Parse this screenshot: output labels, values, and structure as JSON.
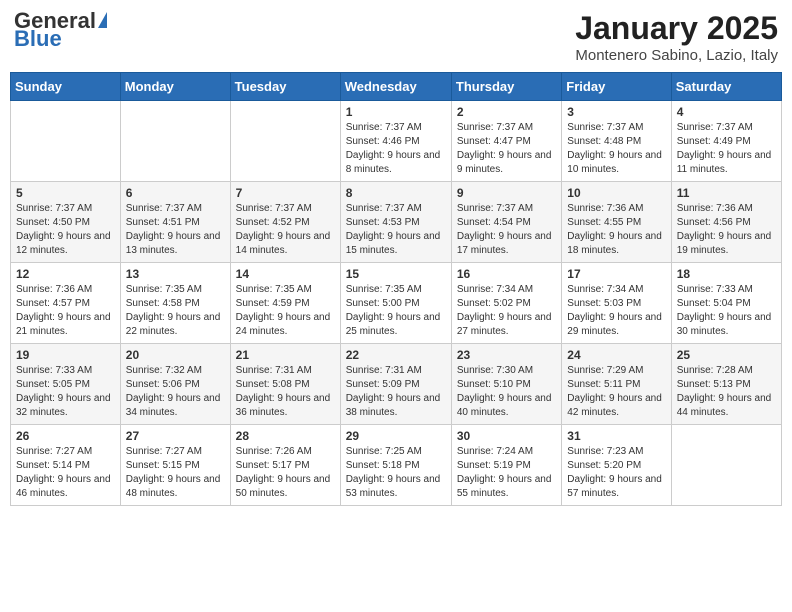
{
  "header": {
    "logo_general": "General",
    "logo_blue": "Blue",
    "month_title": "January 2025",
    "location": "Montenero Sabino, Lazio, Italy"
  },
  "days_of_week": [
    "Sunday",
    "Monday",
    "Tuesday",
    "Wednesday",
    "Thursday",
    "Friday",
    "Saturday"
  ],
  "weeks": [
    [
      {
        "day": "",
        "info": ""
      },
      {
        "day": "",
        "info": ""
      },
      {
        "day": "",
        "info": ""
      },
      {
        "day": "1",
        "info": "Sunrise: 7:37 AM\nSunset: 4:46 PM\nDaylight: 9 hours and 8 minutes."
      },
      {
        "day": "2",
        "info": "Sunrise: 7:37 AM\nSunset: 4:47 PM\nDaylight: 9 hours and 9 minutes."
      },
      {
        "day": "3",
        "info": "Sunrise: 7:37 AM\nSunset: 4:48 PM\nDaylight: 9 hours and 10 minutes."
      },
      {
        "day": "4",
        "info": "Sunrise: 7:37 AM\nSunset: 4:49 PM\nDaylight: 9 hours and 11 minutes."
      }
    ],
    [
      {
        "day": "5",
        "info": "Sunrise: 7:37 AM\nSunset: 4:50 PM\nDaylight: 9 hours and 12 minutes."
      },
      {
        "day": "6",
        "info": "Sunrise: 7:37 AM\nSunset: 4:51 PM\nDaylight: 9 hours and 13 minutes."
      },
      {
        "day": "7",
        "info": "Sunrise: 7:37 AM\nSunset: 4:52 PM\nDaylight: 9 hours and 14 minutes."
      },
      {
        "day": "8",
        "info": "Sunrise: 7:37 AM\nSunset: 4:53 PM\nDaylight: 9 hours and 15 minutes."
      },
      {
        "day": "9",
        "info": "Sunrise: 7:37 AM\nSunset: 4:54 PM\nDaylight: 9 hours and 17 minutes."
      },
      {
        "day": "10",
        "info": "Sunrise: 7:36 AM\nSunset: 4:55 PM\nDaylight: 9 hours and 18 minutes."
      },
      {
        "day": "11",
        "info": "Sunrise: 7:36 AM\nSunset: 4:56 PM\nDaylight: 9 hours and 19 minutes."
      }
    ],
    [
      {
        "day": "12",
        "info": "Sunrise: 7:36 AM\nSunset: 4:57 PM\nDaylight: 9 hours and 21 minutes."
      },
      {
        "day": "13",
        "info": "Sunrise: 7:35 AM\nSunset: 4:58 PM\nDaylight: 9 hours and 22 minutes."
      },
      {
        "day": "14",
        "info": "Sunrise: 7:35 AM\nSunset: 4:59 PM\nDaylight: 9 hours and 24 minutes."
      },
      {
        "day": "15",
        "info": "Sunrise: 7:35 AM\nSunset: 5:00 PM\nDaylight: 9 hours and 25 minutes."
      },
      {
        "day": "16",
        "info": "Sunrise: 7:34 AM\nSunset: 5:02 PM\nDaylight: 9 hours and 27 minutes."
      },
      {
        "day": "17",
        "info": "Sunrise: 7:34 AM\nSunset: 5:03 PM\nDaylight: 9 hours and 29 minutes."
      },
      {
        "day": "18",
        "info": "Sunrise: 7:33 AM\nSunset: 5:04 PM\nDaylight: 9 hours and 30 minutes."
      }
    ],
    [
      {
        "day": "19",
        "info": "Sunrise: 7:33 AM\nSunset: 5:05 PM\nDaylight: 9 hours and 32 minutes."
      },
      {
        "day": "20",
        "info": "Sunrise: 7:32 AM\nSunset: 5:06 PM\nDaylight: 9 hours and 34 minutes."
      },
      {
        "day": "21",
        "info": "Sunrise: 7:31 AM\nSunset: 5:08 PM\nDaylight: 9 hours and 36 minutes."
      },
      {
        "day": "22",
        "info": "Sunrise: 7:31 AM\nSunset: 5:09 PM\nDaylight: 9 hours and 38 minutes."
      },
      {
        "day": "23",
        "info": "Sunrise: 7:30 AM\nSunset: 5:10 PM\nDaylight: 9 hours and 40 minutes."
      },
      {
        "day": "24",
        "info": "Sunrise: 7:29 AM\nSunset: 5:11 PM\nDaylight: 9 hours and 42 minutes."
      },
      {
        "day": "25",
        "info": "Sunrise: 7:28 AM\nSunset: 5:13 PM\nDaylight: 9 hours and 44 minutes."
      }
    ],
    [
      {
        "day": "26",
        "info": "Sunrise: 7:27 AM\nSunset: 5:14 PM\nDaylight: 9 hours and 46 minutes."
      },
      {
        "day": "27",
        "info": "Sunrise: 7:27 AM\nSunset: 5:15 PM\nDaylight: 9 hours and 48 minutes."
      },
      {
        "day": "28",
        "info": "Sunrise: 7:26 AM\nSunset: 5:17 PM\nDaylight: 9 hours and 50 minutes."
      },
      {
        "day": "29",
        "info": "Sunrise: 7:25 AM\nSunset: 5:18 PM\nDaylight: 9 hours and 53 minutes."
      },
      {
        "day": "30",
        "info": "Sunrise: 7:24 AM\nSunset: 5:19 PM\nDaylight: 9 hours and 55 minutes."
      },
      {
        "day": "31",
        "info": "Sunrise: 7:23 AM\nSunset: 5:20 PM\nDaylight: 9 hours and 57 minutes."
      },
      {
        "day": "",
        "info": ""
      }
    ]
  ]
}
